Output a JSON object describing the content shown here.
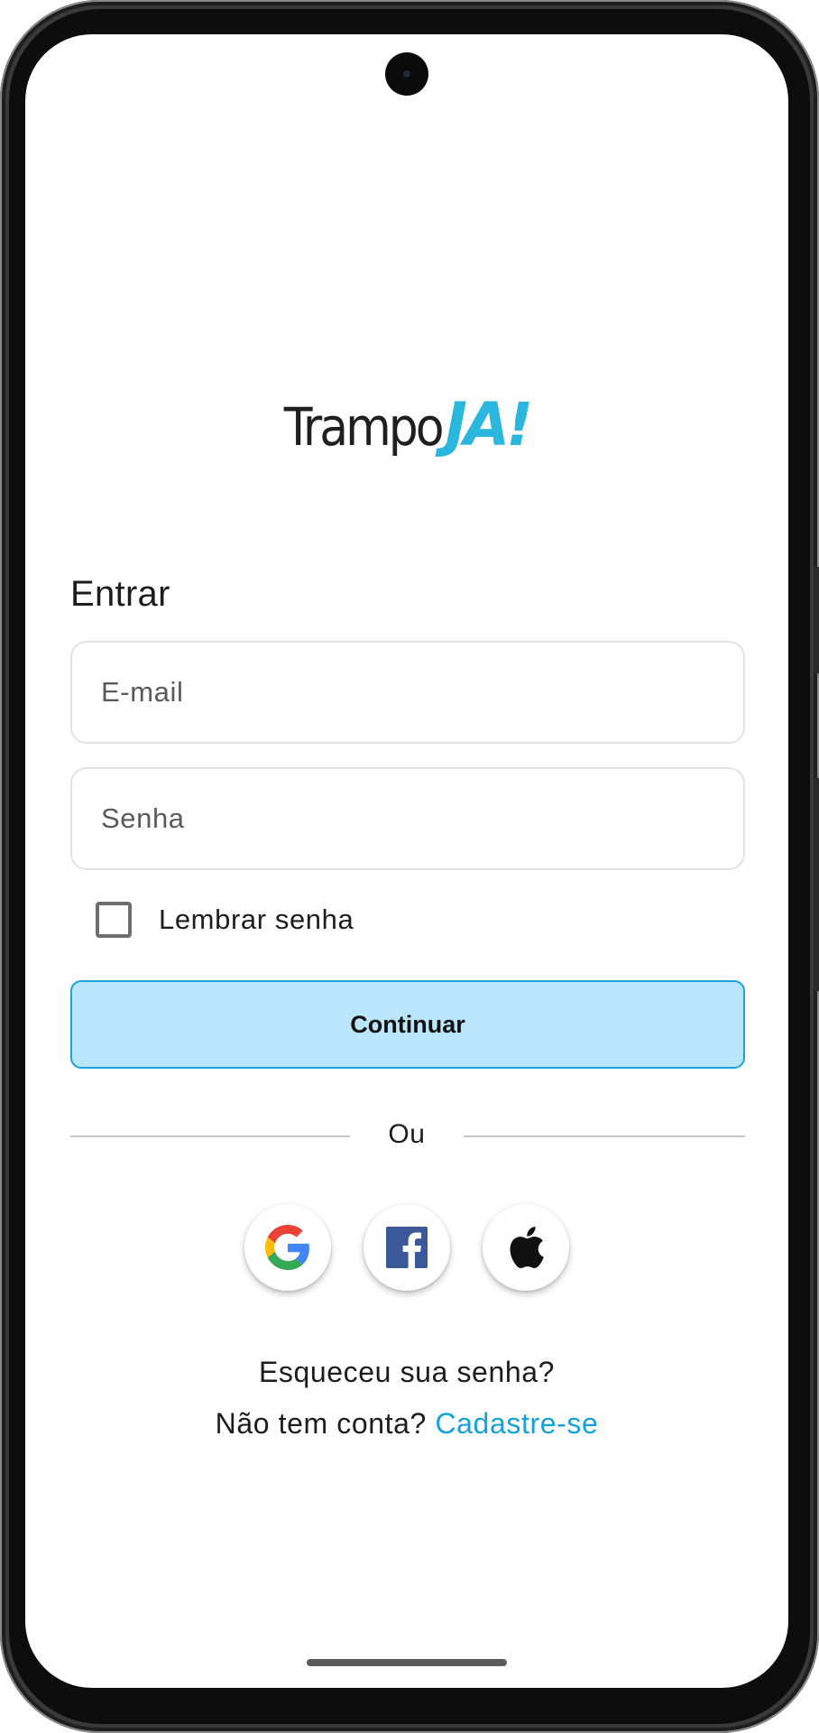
{
  "brand": {
    "logo_part1": "Trampo",
    "logo_part2": "JA!",
    "accent_color": "#2bb6dd"
  },
  "login": {
    "title": "Entrar",
    "email_placeholder": "E-mail",
    "password_placeholder": "Senha",
    "remember_label": "Lembrar senha",
    "remember_checked": false,
    "continue_label": "Continuar",
    "continue_bg_color": "#b9e6fa",
    "continue_border_color": "#1aa3dc"
  },
  "divider": {
    "text": "Ou"
  },
  "social": {
    "buttons": [
      {
        "icon": "google-icon",
        "provider": "Google"
      },
      {
        "icon": "facebook-icon",
        "provider": "Facebook"
      },
      {
        "icon": "apple-icon",
        "provider": "Apple"
      }
    ]
  },
  "footer": {
    "forgot_password": "Esqueceu sua senha?",
    "no_account": "Não tem conta?",
    "signup_link": "Cadastre-se",
    "link_color": "#14a0d8"
  }
}
